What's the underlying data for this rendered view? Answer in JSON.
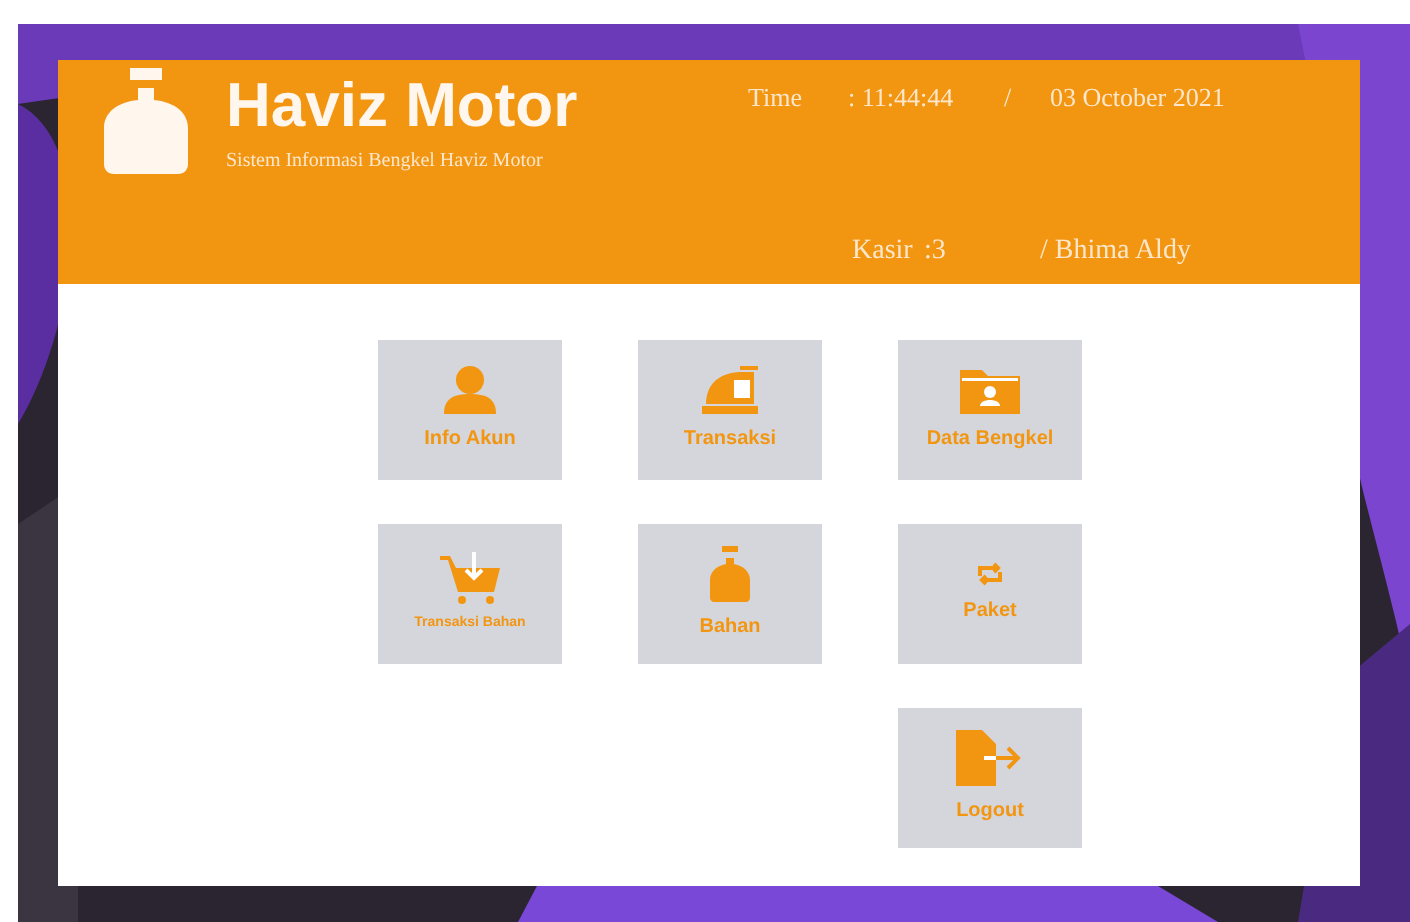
{
  "header": {
    "title": "Haviz Motor",
    "subtitle": "Sistem Informasi Bengkel Haviz Motor",
    "time_label": "Time",
    "time": ": 11:44:44",
    "separator": "/",
    "date": "03 October 2021",
    "cashier_label": "Kasir",
    "cashier_id": ":3",
    "cashier_name": "/ Bhima Aldy"
  },
  "menu_rows": [
    {
      "tiles": [
        {
          "label": "Info Akun",
          "kind": "user"
        },
        {
          "label": "Transaksi",
          "kind": "register"
        },
        {
          "label": "Data Bengkel",
          "kind": "folder"
        }
      ]
    },
    {
      "tiles": [
        {
          "label": "Transaksi Bahan",
          "kind": "cart"
        },
        {
          "label": "Bahan",
          "kind": "bottle"
        },
        {
          "label": "Paket",
          "kind": "refresh"
        }
      ]
    },
    {
      "tiles": [
        {
          "label": "Logout",
          "kind": "logout"
        }
      ]
    }
  ]
}
